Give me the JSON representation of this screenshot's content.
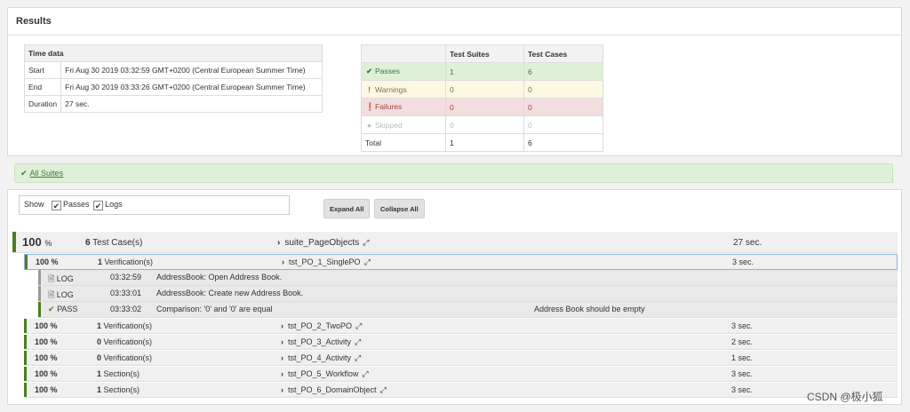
{
  "panel": {
    "title": "Results"
  },
  "time": {
    "header": "Time data",
    "rows": [
      {
        "k": "Start",
        "v": "Fri Aug 30 2019 03:32:59 GMT+0200 (Central European Summer Time)"
      },
      {
        "k": "End",
        "v": "Fri Aug 30 2019 03:33:26 GMT+0200 (Central European Summer Time)"
      },
      {
        "k": "Duration",
        "v": "27 sec."
      }
    ]
  },
  "summary": {
    "headers": [
      "",
      "Test Suites",
      "Test Cases"
    ],
    "passes": {
      "label": "Passes",
      "suites": "1",
      "cases": "6"
    },
    "warnings": {
      "label": "Warnings",
      "suites": "0",
      "cases": "0"
    },
    "failures": {
      "label": "Failures",
      "suites": "0",
      "cases": "0"
    },
    "skipped": {
      "label": "Skipped",
      "suites": "0",
      "cases": "0"
    },
    "total": {
      "label": "Total",
      "suites": "1",
      "cases": "6"
    }
  },
  "suites_link": "All Suites",
  "show": {
    "label": "Show",
    "passes": "Passes",
    "logs": "Logs"
  },
  "buttons": {
    "expand": "Expand All",
    "collapse": "Collapse All"
  },
  "suite": {
    "pct": "100",
    "pct_sign": "%",
    "count": "6",
    "count_label": "Test Case(s)",
    "name": "suite_PageObjects",
    "time": "27 sec."
  },
  "cases": [
    {
      "pct": "100 %",
      "count": "1",
      "label": "Verification(s)",
      "name": "tst_PO_1_SinglePO",
      "time": "3 sec."
    },
    {
      "pct": "100 %",
      "count": "1",
      "label": "Verification(s)",
      "name": "tst_PO_2_TwoPO",
      "time": "3 sec."
    },
    {
      "pct": "100 %",
      "count": "0",
      "label": "Verification(s)",
      "name": "tst_PO_3_Activity",
      "time": "2 sec."
    },
    {
      "pct": "100 %",
      "count": "0",
      "label": "Verification(s)",
      "name": "tst_PO_4_Activity",
      "time": "1 sec."
    },
    {
      "pct": "100 %",
      "count": "1",
      "label": "Section(s)",
      "name": "tst_PO_5_Workflow",
      "time": "3 sec."
    },
    {
      "pct": "100 %",
      "count": "1",
      "label": "Section(s)",
      "name": "tst_PO_6_DomainObject",
      "time": "3 sec."
    }
  ],
  "logs": [
    {
      "type": "LOG",
      "time": "03:32:59",
      "msg": "AddressBook: Open Address Book.",
      "extra": ""
    },
    {
      "type": "LOG",
      "time": "03:33:01",
      "msg": "AddressBook: Create new Address Book.",
      "extra": ""
    },
    {
      "type": "PASS",
      "time": "03:33:02",
      "msg": "Comparison: '0' and '0' are equal",
      "extra": "Address Book should be empty"
    }
  ],
  "watermark": "CSDN @极小狐",
  "colors": {
    "pass_green": "#4e7d1e",
    "log_gray": "#9a9a9a"
  }
}
